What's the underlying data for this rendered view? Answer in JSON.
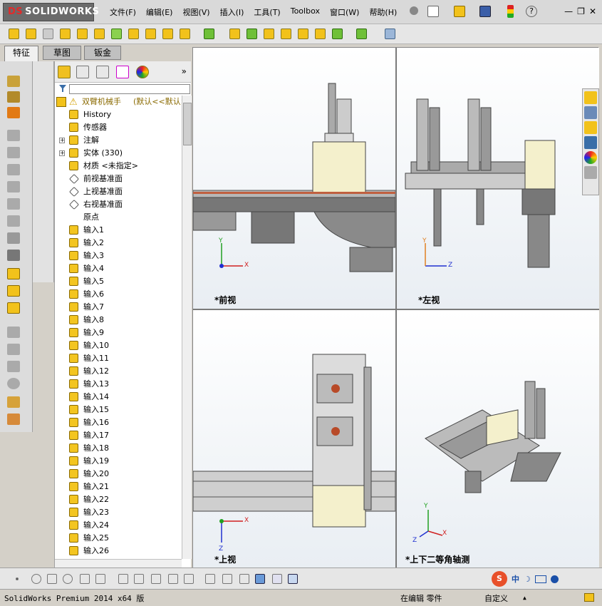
{
  "app": {
    "brand": "SOLIDWORKS",
    "brand_prefix": "DS"
  },
  "menu": [
    "文件(F)",
    "编辑(E)",
    "视图(V)",
    "插入(I)",
    "工具(T)",
    "Toolbox",
    "窗口(W)",
    "帮助(H)"
  ],
  "window_controls": [
    "—",
    "❐",
    "✕"
  ],
  "tabs": [
    {
      "label": "特征",
      "active": true
    },
    {
      "label": "草图",
      "active": false
    },
    {
      "label": "钣金",
      "active": false
    }
  ],
  "tree": {
    "root": "双臂机械手",
    "root_config": "(默认<<默认>",
    "items": [
      {
        "label": "History",
        "type": "history"
      },
      {
        "label": "传感器",
        "type": "sensor"
      },
      {
        "label": "注解",
        "type": "annotation",
        "expand": true
      },
      {
        "label": "实体 (330)",
        "type": "solid",
        "expand": true
      },
      {
        "label": "材质 <未指定>",
        "type": "material"
      },
      {
        "label": "前视基准面",
        "type": "plane"
      },
      {
        "label": "上视基准面",
        "type": "plane"
      },
      {
        "label": "右视基准面",
        "type": "plane"
      },
      {
        "label": "原点",
        "type": "origin"
      },
      {
        "label": "输入1",
        "type": "feat"
      },
      {
        "label": "输入2",
        "type": "feat"
      },
      {
        "label": "输入3",
        "type": "feat"
      },
      {
        "label": "输入4",
        "type": "feat"
      },
      {
        "label": "输入5",
        "type": "feat"
      },
      {
        "label": "输入6",
        "type": "feat"
      },
      {
        "label": "输入7",
        "type": "feat"
      },
      {
        "label": "输入8",
        "type": "feat"
      },
      {
        "label": "输入9",
        "type": "feat"
      },
      {
        "label": "输入10",
        "type": "feat"
      },
      {
        "label": "输入11",
        "type": "feat"
      },
      {
        "label": "输入12",
        "type": "feat"
      },
      {
        "label": "输入13",
        "type": "feat"
      },
      {
        "label": "输入14",
        "type": "feat"
      },
      {
        "label": "输入15",
        "type": "feat"
      },
      {
        "label": "输入16",
        "type": "feat"
      },
      {
        "label": "输入17",
        "type": "feat"
      },
      {
        "label": "输入18",
        "type": "feat"
      },
      {
        "label": "输入19",
        "type": "feat"
      },
      {
        "label": "输入20",
        "type": "feat"
      },
      {
        "label": "输入21",
        "type": "feat"
      },
      {
        "label": "输入22",
        "type": "feat"
      },
      {
        "label": "输入23",
        "type": "feat"
      },
      {
        "label": "输入24",
        "type": "feat"
      },
      {
        "label": "输入25",
        "type": "feat"
      },
      {
        "label": "输入26",
        "type": "feat"
      }
    ]
  },
  "views": {
    "front": "*前视",
    "left": "*左视",
    "top": "*上视",
    "iso": "*上下二等角轴测"
  },
  "axes": {
    "x": "X",
    "y": "Y",
    "z": "Z"
  },
  "status": {
    "product": "SolidWorks Premium 2014 x64 版",
    "mode": "在编辑 零件",
    "custom": "自定义",
    "custom_caret": "▲"
  },
  "ime": {
    "lang": "中",
    "moon": "☽"
  },
  "colors": {
    "accent": "#f3c520",
    "axis_x": "#d02020",
    "axis_y": "#20a020",
    "axis_z": "#2030d0",
    "part": "#9a9a9a",
    "block": "#f4f0cc"
  }
}
